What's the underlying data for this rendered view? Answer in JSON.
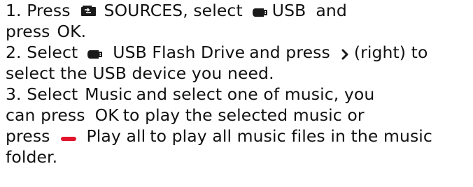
{
  "instructions": {
    "step1": {
      "text_a": "1. Press",
      "sources_label": "SOURCES",
      "text_b": ", select",
      "usb_label": "USB",
      "text_c": "and",
      "text_d": "press",
      "ok_label": "OK",
      "text_e": "."
    },
    "step2": {
      "text_a": "2. Select",
      "usb_drive_label": "USB Flash Drive",
      "text_b": "and press",
      "text_c": "(right) to",
      "text_d": "select the USB device you need."
    },
    "step3": {
      "text_a": "3. Select",
      "music_label": "Music",
      "text_b": "and select one of music, you",
      "text_c": "can press",
      "ok_label": "OK",
      "text_d": "to play the selected music or",
      "text_e": "press",
      "play_all_label": "Play all",
      "text_f": "to play all music files in the music",
      "text_g": "folder."
    }
  },
  "icons": {
    "sources": "sources-icon",
    "usb": "usb-drive-icon",
    "right_arrow": "chevron-right-icon",
    "red_key": "red-key-icon"
  },
  "colors": {
    "text": "#111111",
    "icon_dark": "#1a1a1a",
    "red_key": "#e3132b"
  }
}
